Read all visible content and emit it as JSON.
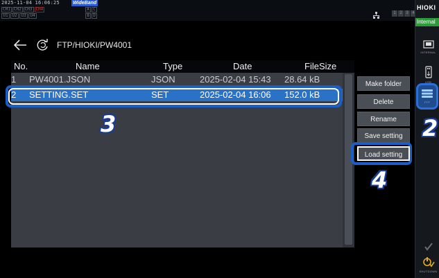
{
  "status": {
    "timestamp": "2025-11-04 16:06:25",
    "mode_badge": "WideBand",
    "channels_row1": [
      "CH1",
      "CH2",
      "CH3",
      "CH4"
    ],
    "channels_row2": [
      "U1",
      "U2",
      "U3",
      "U4"
    ],
    "ab_row1": [
      "A",
      "C"
    ],
    "ab_row2": [
      "B",
      "D"
    ],
    "indicator_numbers": [
      "1",
      "2",
      "3",
      "4"
    ]
  },
  "sidebar": {
    "brand": "HIOKI",
    "internal_tag": "Internal",
    "buttons": [
      {
        "label": "INTERNAL"
      },
      {
        "label": "USB"
      },
      {
        "label": "FTP"
      },
      {
        "label": "SHUTDOWN"
      }
    ]
  },
  "nav": {
    "path": "FTP/HIOKI/PW4001"
  },
  "table": {
    "columns": [
      "No.",
      "Name",
      "Type",
      "Date",
      "FileSize"
    ],
    "rows": [
      {
        "no": "1",
        "name": "PW4001.JSON",
        "type": "JSON",
        "date": "2025-02-04 15:43",
        "size": "28.64 kB"
      },
      {
        "no": "2",
        "name": "SETTING.SET",
        "type": "SET",
        "date": "2025-02-04 16:06",
        "size": "152.0 kB"
      }
    ],
    "selected_row": 2
  },
  "commands": {
    "make_folder": "Make folder",
    "delete": "Delete",
    "rename": "Rename",
    "save_setting": "Save setting",
    "load_setting": "Load setting"
  },
  "annotations": {
    "step2": "2",
    "step3": "3",
    "step4": "4"
  },
  "colors": {
    "selection": "#2a71c8",
    "highlight_border": "#1b5fc5",
    "internal_green": "#2e9b3a"
  }
}
